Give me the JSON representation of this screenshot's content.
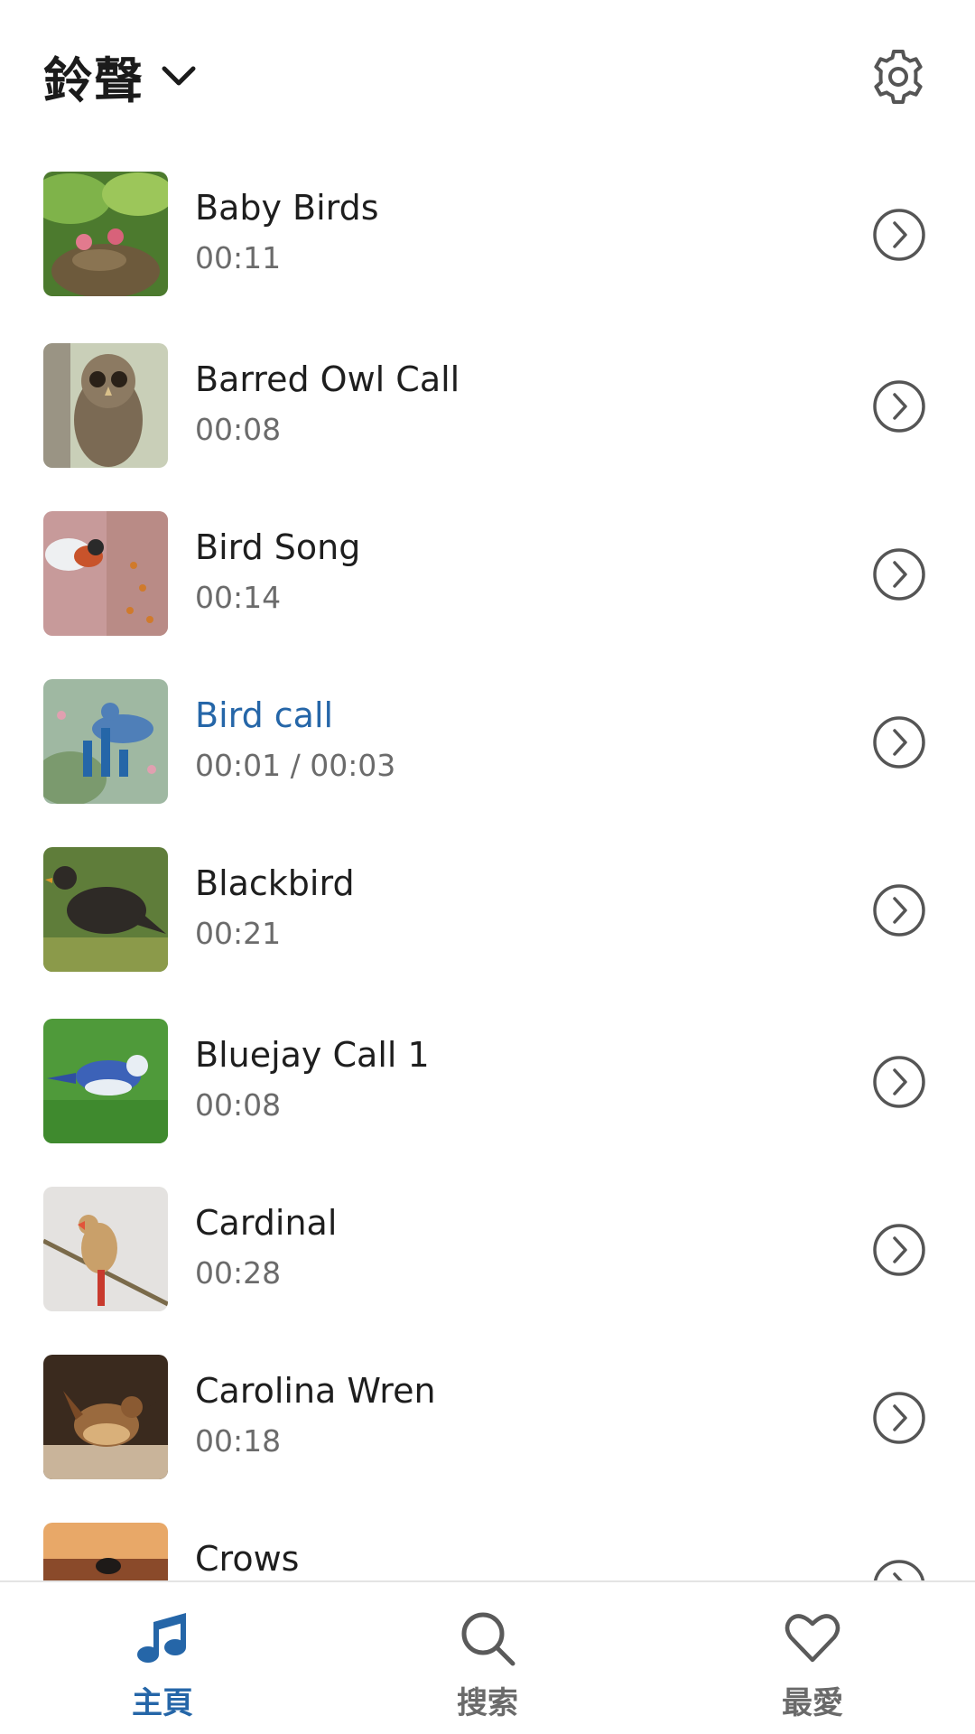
{
  "header": {
    "title": "鈴聲",
    "dropdown_icon": "chevron-down-icon",
    "settings_icon": "gear-icon"
  },
  "colors": {
    "accent": "#2566a8",
    "text_primary": "#1e1e1e",
    "text_secondary": "#6b6b6b",
    "icon": "#555555"
  },
  "list": {
    "items": [
      {
        "title": "Baby Birds",
        "duration": "00:11"
      },
      {
        "title": "Barred Owl Call",
        "duration": "00:08"
      },
      {
        "title": "Bird Song",
        "duration": "00:14"
      },
      {
        "title": "Bird call",
        "duration": "00:01 / 00:03",
        "playing": true
      },
      {
        "title": "Blackbird",
        "duration": "00:21"
      },
      {
        "title": "Bluejay Call 1",
        "duration": "00:08"
      },
      {
        "title": "Cardinal",
        "duration": "00:28"
      },
      {
        "title": "Carolina Wren",
        "duration": "00:18"
      },
      {
        "title": "Crows",
        "duration": ""
      }
    ]
  },
  "bottom_nav": {
    "tabs": [
      {
        "label": "主頁",
        "icon": "music-note-icon",
        "active": true
      },
      {
        "label": "搜索",
        "icon": "search-icon",
        "active": false
      },
      {
        "label": "最愛",
        "icon": "heart-icon",
        "active": false
      }
    ]
  }
}
